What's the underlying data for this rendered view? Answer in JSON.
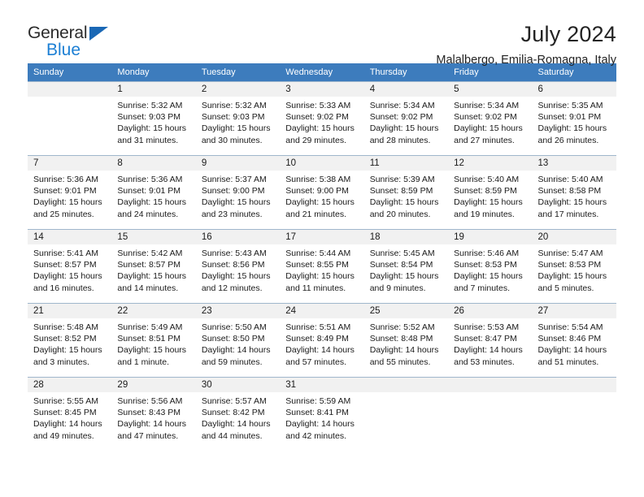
{
  "brand": {
    "line1": "General",
    "line2": "Blue",
    "mark": "triangle-logo"
  },
  "header": {
    "title": "July 2024",
    "subtitle": "Malalbergo, Emilia-Romagna, Italy"
  },
  "weekday_headers": [
    "Sunday",
    "Monday",
    "Tuesday",
    "Wednesday",
    "Thursday",
    "Friday",
    "Saturday"
  ],
  "colors": {
    "header_bar": "#3d7cbd",
    "daynum_bar": "#f1f1f1",
    "brand_blue": "#1c7fd4",
    "grid_line": "#9fb6cc"
  },
  "weeks": [
    [
      {
        "day": "",
        "lines": []
      },
      {
        "day": "1",
        "lines": [
          "Sunrise: 5:32 AM",
          "Sunset: 9:03 PM",
          "Daylight: 15 hours",
          "and 31 minutes."
        ]
      },
      {
        "day": "2",
        "lines": [
          "Sunrise: 5:32 AM",
          "Sunset: 9:03 PM",
          "Daylight: 15 hours",
          "and 30 minutes."
        ]
      },
      {
        "day": "3",
        "lines": [
          "Sunrise: 5:33 AM",
          "Sunset: 9:02 PM",
          "Daylight: 15 hours",
          "and 29 minutes."
        ]
      },
      {
        "day": "4",
        "lines": [
          "Sunrise: 5:34 AM",
          "Sunset: 9:02 PM",
          "Daylight: 15 hours",
          "and 28 minutes."
        ]
      },
      {
        "day": "5",
        "lines": [
          "Sunrise: 5:34 AM",
          "Sunset: 9:02 PM",
          "Daylight: 15 hours",
          "and 27 minutes."
        ]
      },
      {
        "day": "6",
        "lines": [
          "Sunrise: 5:35 AM",
          "Sunset: 9:01 PM",
          "Daylight: 15 hours",
          "and 26 minutes."
        ]
      }
    ],
    [
      {
        "day": "7",
        "lines": [
          "Sunrise: 5:36 AM",
          "Sunset: 9:01 PM",
          "Daylight: 15 hours",
          "and 25 minutes."
        ]
      },
      {
        "day": "8",
        "lines": [
          "Sunrise: 5:36 AM",
          "Sunset: 9:01 PM",
          "Daylight: 15 hours",
          "and 24 minutes."
        ]
      },
      {
        "day": "9",
        "lines": [
          "Sunrise: 5:37 AM",
          "Sunset: 9:00 PM",
          "Daylight: 15 hours",
          "and 23 minutes."
        ]
      },
      {
        "day": "10",
        "lines": [
          "Sunrise: 5:38 AM",
          "Sunset: 9:00 PM",
          "Daylight: 15 hours",
          "and 21 minutes."
        ]
      },
      {
        "day": "11",
        "lines": [
          "Sunrise: 5:39 AM",
          "Sunset: 8:59 PM",
          "Daylight: 15 hours",
          "and 20 minutes."
        ]
      },
      {
        "day": "12",
        "lines": [
          "Sunrise: 5:40 AM",
          "Sunset: 8:59 PM",
          "Daylight: 15 hours",
          "and 19 minutes."
        ]
      },
      {
        "day": "13",
        "lines": [
          "Sunrise: 5:40 AM",
          "Sunset: 8:58 PM",
          "Daylight: 15 hours",
          "and 17 minutes."
        ]
      }
    ],
    [
      {
        "day": "14",
        "lines": [
          "Sunrise: 5:41 AM",
          "Sunset: 8:57 PM",
          "Daylight: 15 hours",
          "and 16 minutes."
        ]
      },
      {
        "day": "15",
        "lines": [
          "Sunrise: 5:42 AM",
          "Sunset: 8:57 PM",
          "Daylight: 15 hours",
          "and 14 minutes."
        ]
      },
      {
        "day": "16",
        "lines": [
          "Sunrise: 5:43 AM",
          "Sunset: 8:56 PM",
          "Daylight: 15 hours",
          "and 12 minutes."
        ]
      },
      {
        "day": "17",
        "lines": [
          "Sunrise: 5:44 AM",
          "Sunset: 8:55 PM",
          "Daylight: 15 hours",
          "and 11 minutes."
        ]
      },
      {
        "day": "18",
        "lines": [
          "Sunrise: 5:45 AM",
          "Sunset: 8:54 PM",
          "Daylight: 15 hours",
          "and 9 minutes."
        ]
      },
      {
        "day": "19",
        "lines": [
          "Sunrise: 5:46 AM",
          "Sunset: 8:53 PM",
          "Daylight: 15 hours",
          "and 7 minutes."
        ]
      },
      {
        "day": "20",
        "lines": [
          "Sunrise: 5:47 AM",
          "Sunset: 8:53 PM",
          "Daylight: 15 hours",
          "and 5 minutes."
        ]
      }
    ],
    [
      {
        "day": "21",
        "lines": [
          "Sunrise: 5:48 AM",
          "Sunset: 8:52 PM",
          "Daylight: 15 hours",
          "and 3 minutes."
        ]
      },
      {
        "day": "22",
        "lines": [
          "Sunrise: 5:49 AM",
          "Sunset: 8:51 PM",
          "Daylight: 15 hours",
          "and 1 minute."
        ]
      },
      {
        "day": "23",
        "lines": [
          "Sunrise: 5:50 AM",
          "Sunset: 8:50 PM",
          "Daylight: 14 hours",
          "and 59 minutes."
        ]
      },
      {
        "day": "24",
        "lines": [
          "Sunrise: 5:51 AM",
          "Sunset: 8:49 PM",
          "Daylight: 14 hours",
          "and 57 minutes."
        ]
      },
      {
        "day": "25",
        "lines": [
          "Sunrise: 5:52 AM",
          "Sunset: 8:48 PM",
          "Daylight: 14 hours",
          "and 55 minutes."
        ]
      },
      {
        "day": "26",
        "lines": [
          "Sunrise: 5:53 AM",
          "Sunset: 8:47 PM",
          "Daylight: 14 hours",
          "and 53 minutes."
        ]
      },
      {
        "day": "27",
        "lines": [
          "Sunrise: 5:54 AM",
          "Sunset: 8:46 PM",
          "Daylight: 14 hours",
          "and 51 minutes."
        ]
      }
    ],
    [
      {
        "day": "28",
        "lines": [
          "Sunrise: 5:55 AM",
          "Sunset: 8:45 PM",
          "Daylight: 14 hours",
          "and 49 minutes."
        ]
      },
      {
        "day": "29",
        "lines": [
          "Sunrise: 5:56 AM",
          "Sunset: 8:43 PM",
          "Daylight: 14 hours",
          "and 47 minutes."
        ]
      },
      {
        "day": "30",
        "lines": [
          "Sunrise: 5:57 AM",
          "Sunset: 8:42 PM",
          "Daylight: 14 hours",
          "and 44 minutes."
        ]
      },
      {
        "day": "31",
        "lines": [
          "Sunrise: 5:59 AM",
          "Sunset: 8:41 PM",
          "Daylight: 14 hours",
          "and 42 minutes."
        ]
      },
      {
        "day": "",
        "lines": []
      },
      {
        "day": "",
        "lines": []
      },
      {
        "day": "",
        "lines": []
      }
    ]
  ]
}
